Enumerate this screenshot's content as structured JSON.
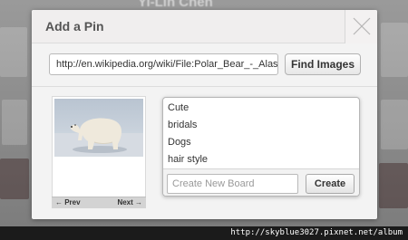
{
  "background": {
    "profile_name": "Yi-Lin Chen"
  },
  "modal": {
    "title": "Add a Pin",
    "close_icon": "close-x-icon"
  },
  "url_bar": {
    "value": "http://en.wikipedia.org/wiki/File:Polar_Bear_-_Alas",
    "find_label": "Find Images"
  },
  "preview": {
    "image_subject": "polar bear",
    "prev_label": "← Prev",
    "next_label": "Next →"
  },
  "boards": {
    "items": [
      "Cute",
      "bridals",
      "Dogs",
      "hair style"
    ],
    "new_board_placeholder": "Create New Board",
    "create_label": "Create"
  },
  "watermark": "http://skyblue3027.pixnet.net/album",
  "colors": {
    "accent_red": "#c9292d",
    "modal_bg": "#f3f3f3"
  }
}
